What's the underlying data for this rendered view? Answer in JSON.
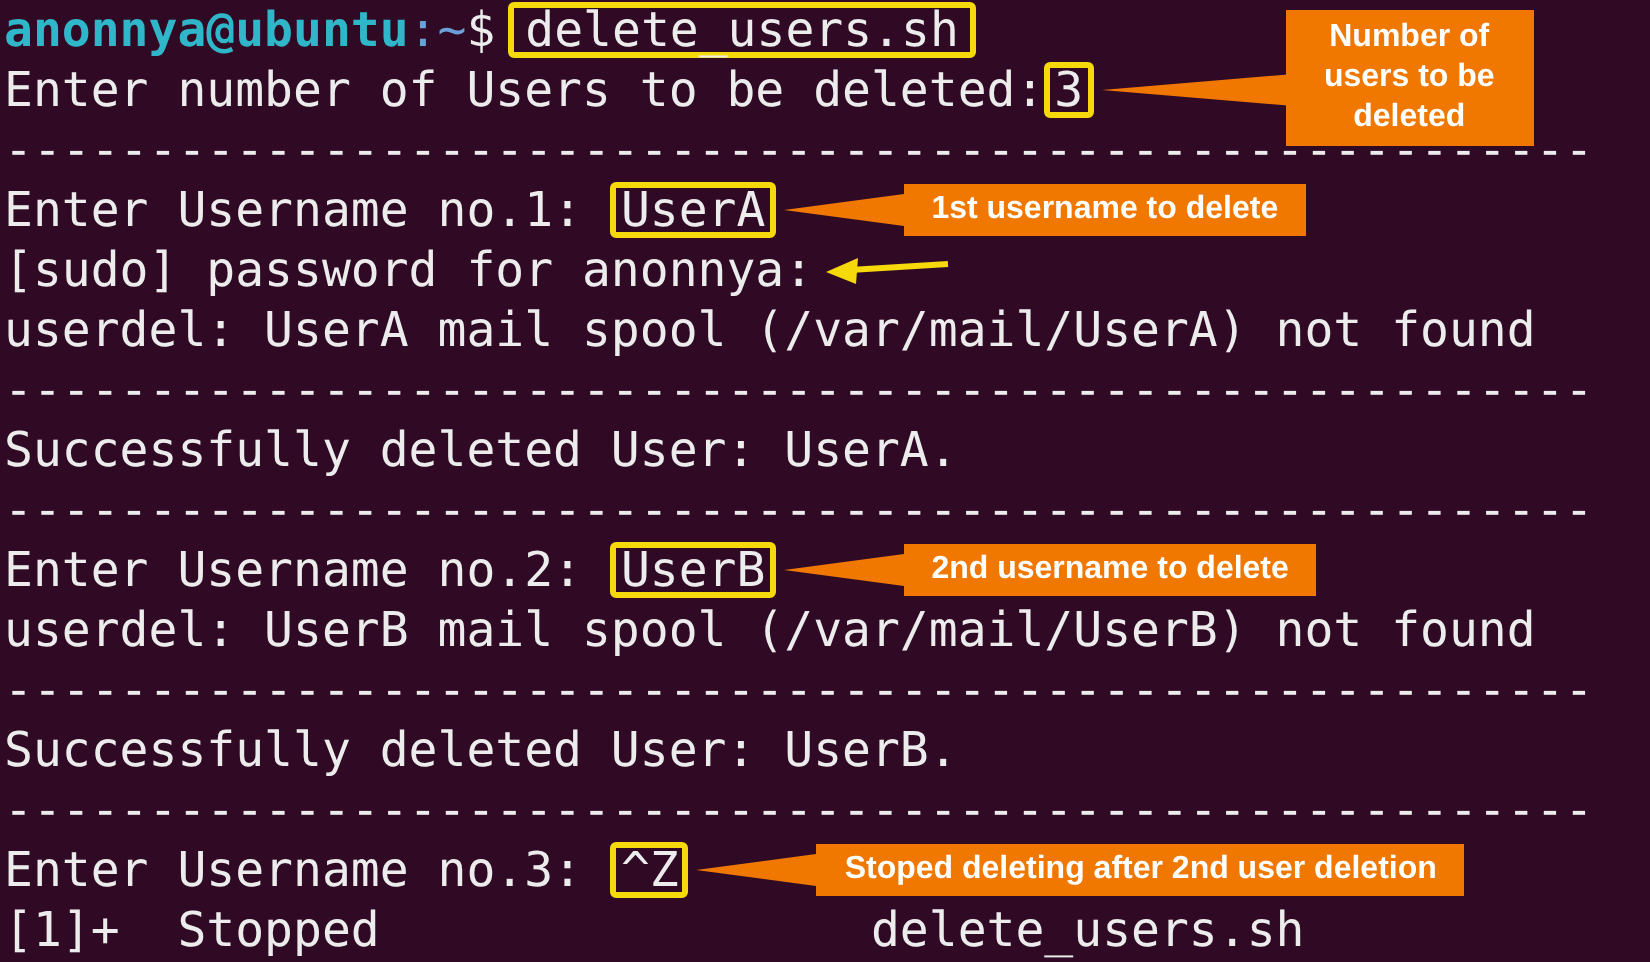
{
  "terminal": {
    "lines": [
      {
        "kind": "prompt",
        "user_host": "anonnya@ubuntu",
        "path": ":~",
        "sign": "$",
        "command": "delete_users.sh"
      },
      {
        "kind": "input",
        "text": "Enter number of Users to be deleted:",
        "value": "3",
        "callout": "Number of users to be deleted"
      },
      {
        "kind": "separator",
        "text": "-------------------------------------------------------"
      },
      {
        "kind": "input",
        "text": "Enter Username no.1: ",
        "value": "UserA",
        "callout": "1st username to delete"
      },
      {
        "kind": "pointed",
        "text": "[sudo] password for anonnya:"
      },
      {
        "kind": "output",
        "text": "userdel: UserA mail spool (/var/mail/UserA) not found"
      },
      {
        "kind": "separator",
        "text": "-------------------------------------------------------"
      },
      {
        "kind": "output",
        "text": "Successfully deleted User: UserA."
      },
      {
        "kind": "separator",
        "text": "-------------------------------------------------------"
      },
      {
        "kind": "input",
        "text": "Enter Username no.2: ",
        "value": "UserB",
        "callout": "2nd username to delete"
      },
      {
        "kind": "output",
        "text": "userdel: UserB mail spool (/var/mail/UserB) not found"
      },
      {
        "kind": "separator",
        "text": "-------------------------------------------------------"
      },
      {
        "kind": "output",
        "text": "Successfully deleted User: UserB."
      },
      {
        "kind": "separator",
        "text": "-------------------------------------------------------"
      },
      {
        "kind": "input",
        "text": "Enter Username no.3: ",
        "value": "^Z",
        "callout": "Stoped deleting after 2nd user deletion"
      },
      {
        "kind": "output",
        "text": "[1]+  Stopped                 delete_users.sh"
      }
    ]
  }
}
